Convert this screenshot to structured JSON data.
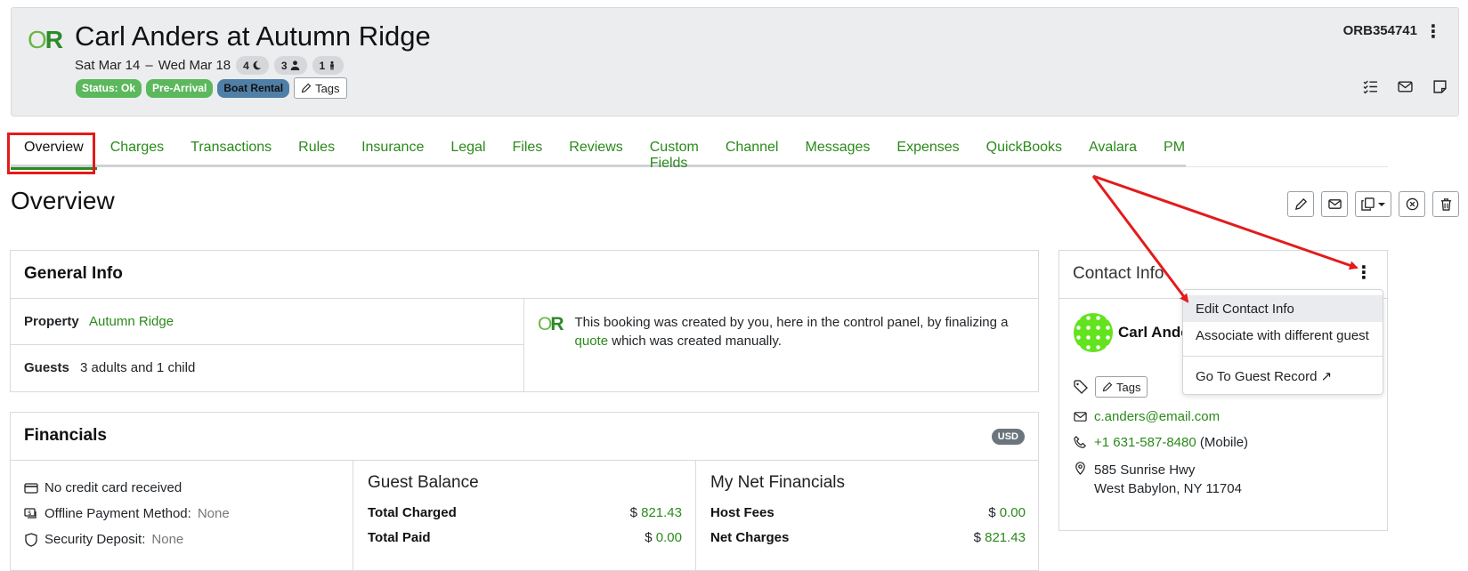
{
  "header": {
    "logo_o": "O",
    "logo_r": "R",
    "title": "Carl Anders at Autumn Ridge",
    "date_start": "Sat Mar 14",
    "date_sep": "–",
    "date_end": "Wed Mar 18",
    "nights": "4",
    "adults": "3",
    "children": "1",
    "badges": [
      "Status: Ok",
      "Pre-Arrival",
      "Boat Rental"
    ],
    "tags_label": "Tags",
    "confirmation": "ORB354741"
  },
  "tabs": [
    "Overview",
    "Charges",
    "Transactions",
    "Rules",
    "Insurance",
    "Legal",
    "Files",
    "Reviews",
    "Custom Fields",
    "Channel",
    "Messages",
    "Expenses",
    "QuickBooks",
    "Avalara",
    "PM"
  ],
  "overview": {
    "title": "Overview"
  },
  "general_info": {
    "title": "General Info",
    "property_label": "Property",
    "property_value": "Autumn Ridge",
    "guests_label": "Guests",
    "guests_value": "3 adults and 1 child",
    "note_part1": "This booking was created by you, here in the control panel, by finalizing a",
    "note_link": "quote",
    "note_part2": "which was created manually."
  },
  "financials": {
    "title": "Financials",
    "currency": "USD",
    "no_card": "No credit card received",
    "offline_label": "Offline Payment Method:",
    "offline_value": "None",
    "deposit_label": "Security Deposit:",
    "deposit_value": "None",
    "guest_balance": {
      "title": "Guest Balance",
      "total_charged_label": "Total Charged",
      "total_charged_value": "821.43",
      "total_paid_label": "Total Paid",
      "total_paid_value": "0.00"
    },
    "net": {
      "title": "My Net Financials",
      "host_fees_label": "Host Fees",
      "host_fees_value": "0.00",
      "net_charges_label": "Net Charges",
      "net_charges_value": "821.43"
    },
    "currency_symbol": "$"
  },
  "contact": {
    "title": "Contact Info",
    "name": "Carl Anders",
    "tags_label": "Tags",
    "email": "c.anders@email.com",
    "phone": "+1 631-587-8480",
    "phone_type": "(Mobile)",
    "address_line1": "585 Sunrise Hwy",
    "address_line2": "West Babylon, NY 11704"
  },
  "dropdown": {
    "items": [
      "Edit Contact Info",
      "Associate with different guest",
      "Go To Guest Record ↗"
    ]
  },
  "colors": {
    "accent": "#2a8a1a",
    "status_ok": "#5cb85c",
    "boat_badge": "#4f7fa6",
    "annotation": "#e31b1b"
  }
}
